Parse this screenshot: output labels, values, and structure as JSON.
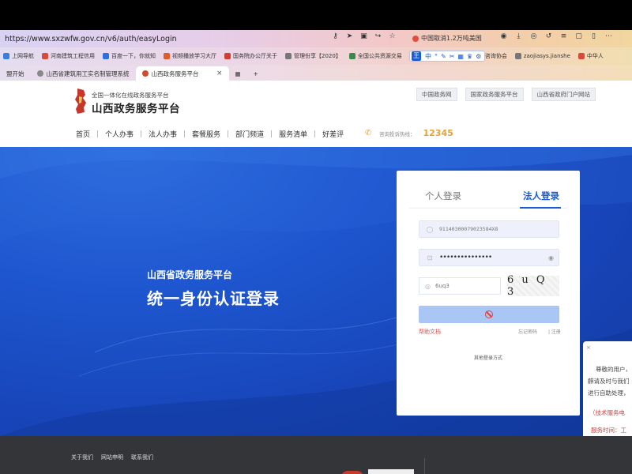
{
  "browser": {
    "url": "https://www.sxzwfw.gov.cn/v6/auth/easyLogin",
    "news_ticker": "中国取消1.2万吨美国",
    "bookmarks": [
      {
        "label": "上网导航",
        "color": "#3a7de0"
      },
      {
        "label": "河南建筑工程信用",
        "color": "#d84a3a"
      },
      {
        "label": "百度一下，你就知",
        "color": "#2f6fe0"
      },
      {
        "label": "视频播放学习大厅",
        "color": "#e05a2a"
      },
      {
        "label": "国务院办公厅关于",
        "color": "#d0402f"
      },
      {
        "label": "管理份享【2020】",
        "color": "#777777"
      },
      {
        "label": "全国公共资源交易",
        "color": "#3a8a4a"
      },
      {
        "label": "中华人民共",
        "color": "#d84a3a"
      },
      {
        "label": "中国工程咨询协会",
        "color": "#d84a3a"
      },
      {
        "label": "zaojiasys.jianshe",
        "color": "#777777"
      },
      {
        "label": "中华人",
        "color": "#d84a3a"
      }
    ],
    "mini_toolbar": {
      "badge": "王",
      "items": [
        "中",
        "°",
        "✎",
        "✂",
        "▦",
        "♛",
        "⚙"
      ]
    },
    "tabs": [
      {
        "label": "盟开始",
        "active": false
      },
      {
        "label": "山西省建筑用工实名制管理系统",
        "active": false
      },
      {
        "label": "山西政务服务平台",
        "active": true
      }
    ],
    "new_tab_symbol": "+"
  },
  "header": {
    "subtitle": "全国一体化在线政务服务平台",
    "title": "山西政务服务平台",
    "top_links": [
      "中国政务网",
      "国家政务服务平台",
      "山西省政府门户网站"
    ],
    "nav": [
      "首页",
      "个人办事",
      "法人办事",
      "套餐服务",
      "部门频道",
      "服务清单",
      "好差评"
    ],
    "hotline_label": "咨询投诉热线：",
    "hotline_number": "12345"
  },
  "hero": {
    "subtitle": "山西省政务服务平台",
    "title": "统一身份认证登录"
  },
  "login": {
    "tab_personal": "个人登录",
    "tab_corporate": "法人登录",
    "account_value": "91140300079023584X8",
    "password_value": "•••••••••••••••",
    "captcha_value": "6uq3",
    "captcha_image_text": "6 u Q 3",
    "help_link": "帮助文档",
    "forgot_link": "忘记密码",
    "register_link": "| 注册",
    "other_methods": "其他登录方式"
  },
  "side_popup": {
    "close": "×",
    "line1": "尊敬的用户，",
    "line2": "麒请及时与我们",
    "line3": "进行自助处理，",
    "line4": "（技术服务电",
    "line5": "服务时间：工"
  },
  "footer": {
    "links": [
      "关于我们",
      "网站申明",
      "联系我们"
    ]
  }
}
